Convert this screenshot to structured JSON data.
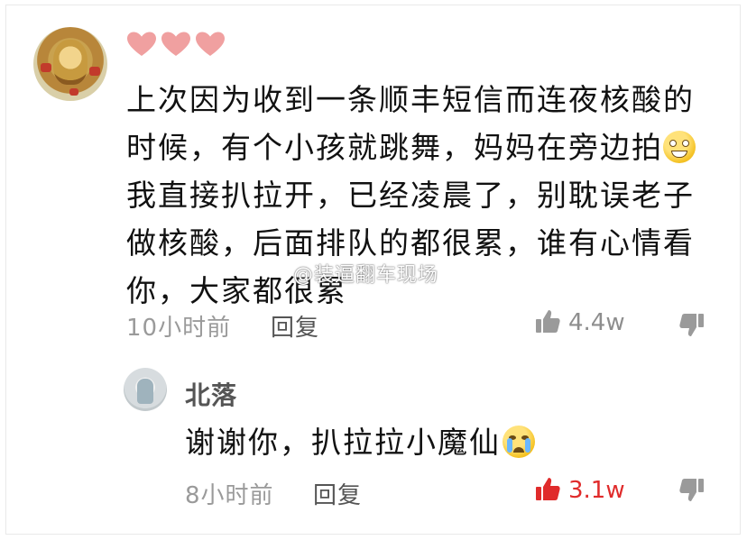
{
  "comment": {
    "hearts": [
      "heart-icon",
      "heart-icon",
      "heart-icon"
    ],
    "lines": [
      "上次因为收到一条顺丰短信而连夜核酸的",
      "时候，有个小孩就跳舞，妈妈在旁边拍",
      "我直接扒拉开，已经凌晨了，别耽误老子",
      "做核酸，后面排队的都很累，谁有心情看",
      "你，大家都很累"
    ],
    "time": "10小时前",
    "reply_label": "回复",
    "likes": "4.4w"
  },
  "reply": {
    "name": "北落",
    "text": "谢谢你，扒拉拉小魔仙",
    "time": "8小时前",
    "reply_label": "回复",
    "likes": "3.1w"
  },
  "watermark": "@装逼翻车现场",
  "colors": {
    "heart": "#f0a0a0",
    "like_active": "#e02b2b",
    "muted_text": "#9a9a9a"
  }
}
